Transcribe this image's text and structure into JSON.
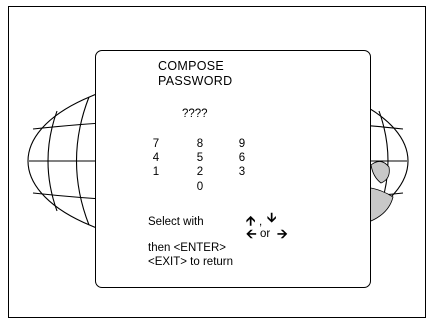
{
  "dialog": {
    "title_line1": "COMPOSE",
    "title_line2": "PASSWORD",
    "password_display": "????",
    "keypad": {
      "k7": "7",
      "k8": "8",
      "k9": "9",
      "k4": "4",
      "k5": "5",
      "k6": "6",
      "k1": "1",
      "k2": "2",
      "k3": "3",
      "k0": "0"
    },
    "select_with": "Select with",
    "comma": ",",
    "or": "or",
    "then_enter": "then <ENTER>",
    "exit_return": "<EXIT> to return",
    "arrow_up": "🡩",
    "arrow_down": "🡫",
    "arrow_left": "🡨",
    "arrow_right": "🡪"
  }
}
